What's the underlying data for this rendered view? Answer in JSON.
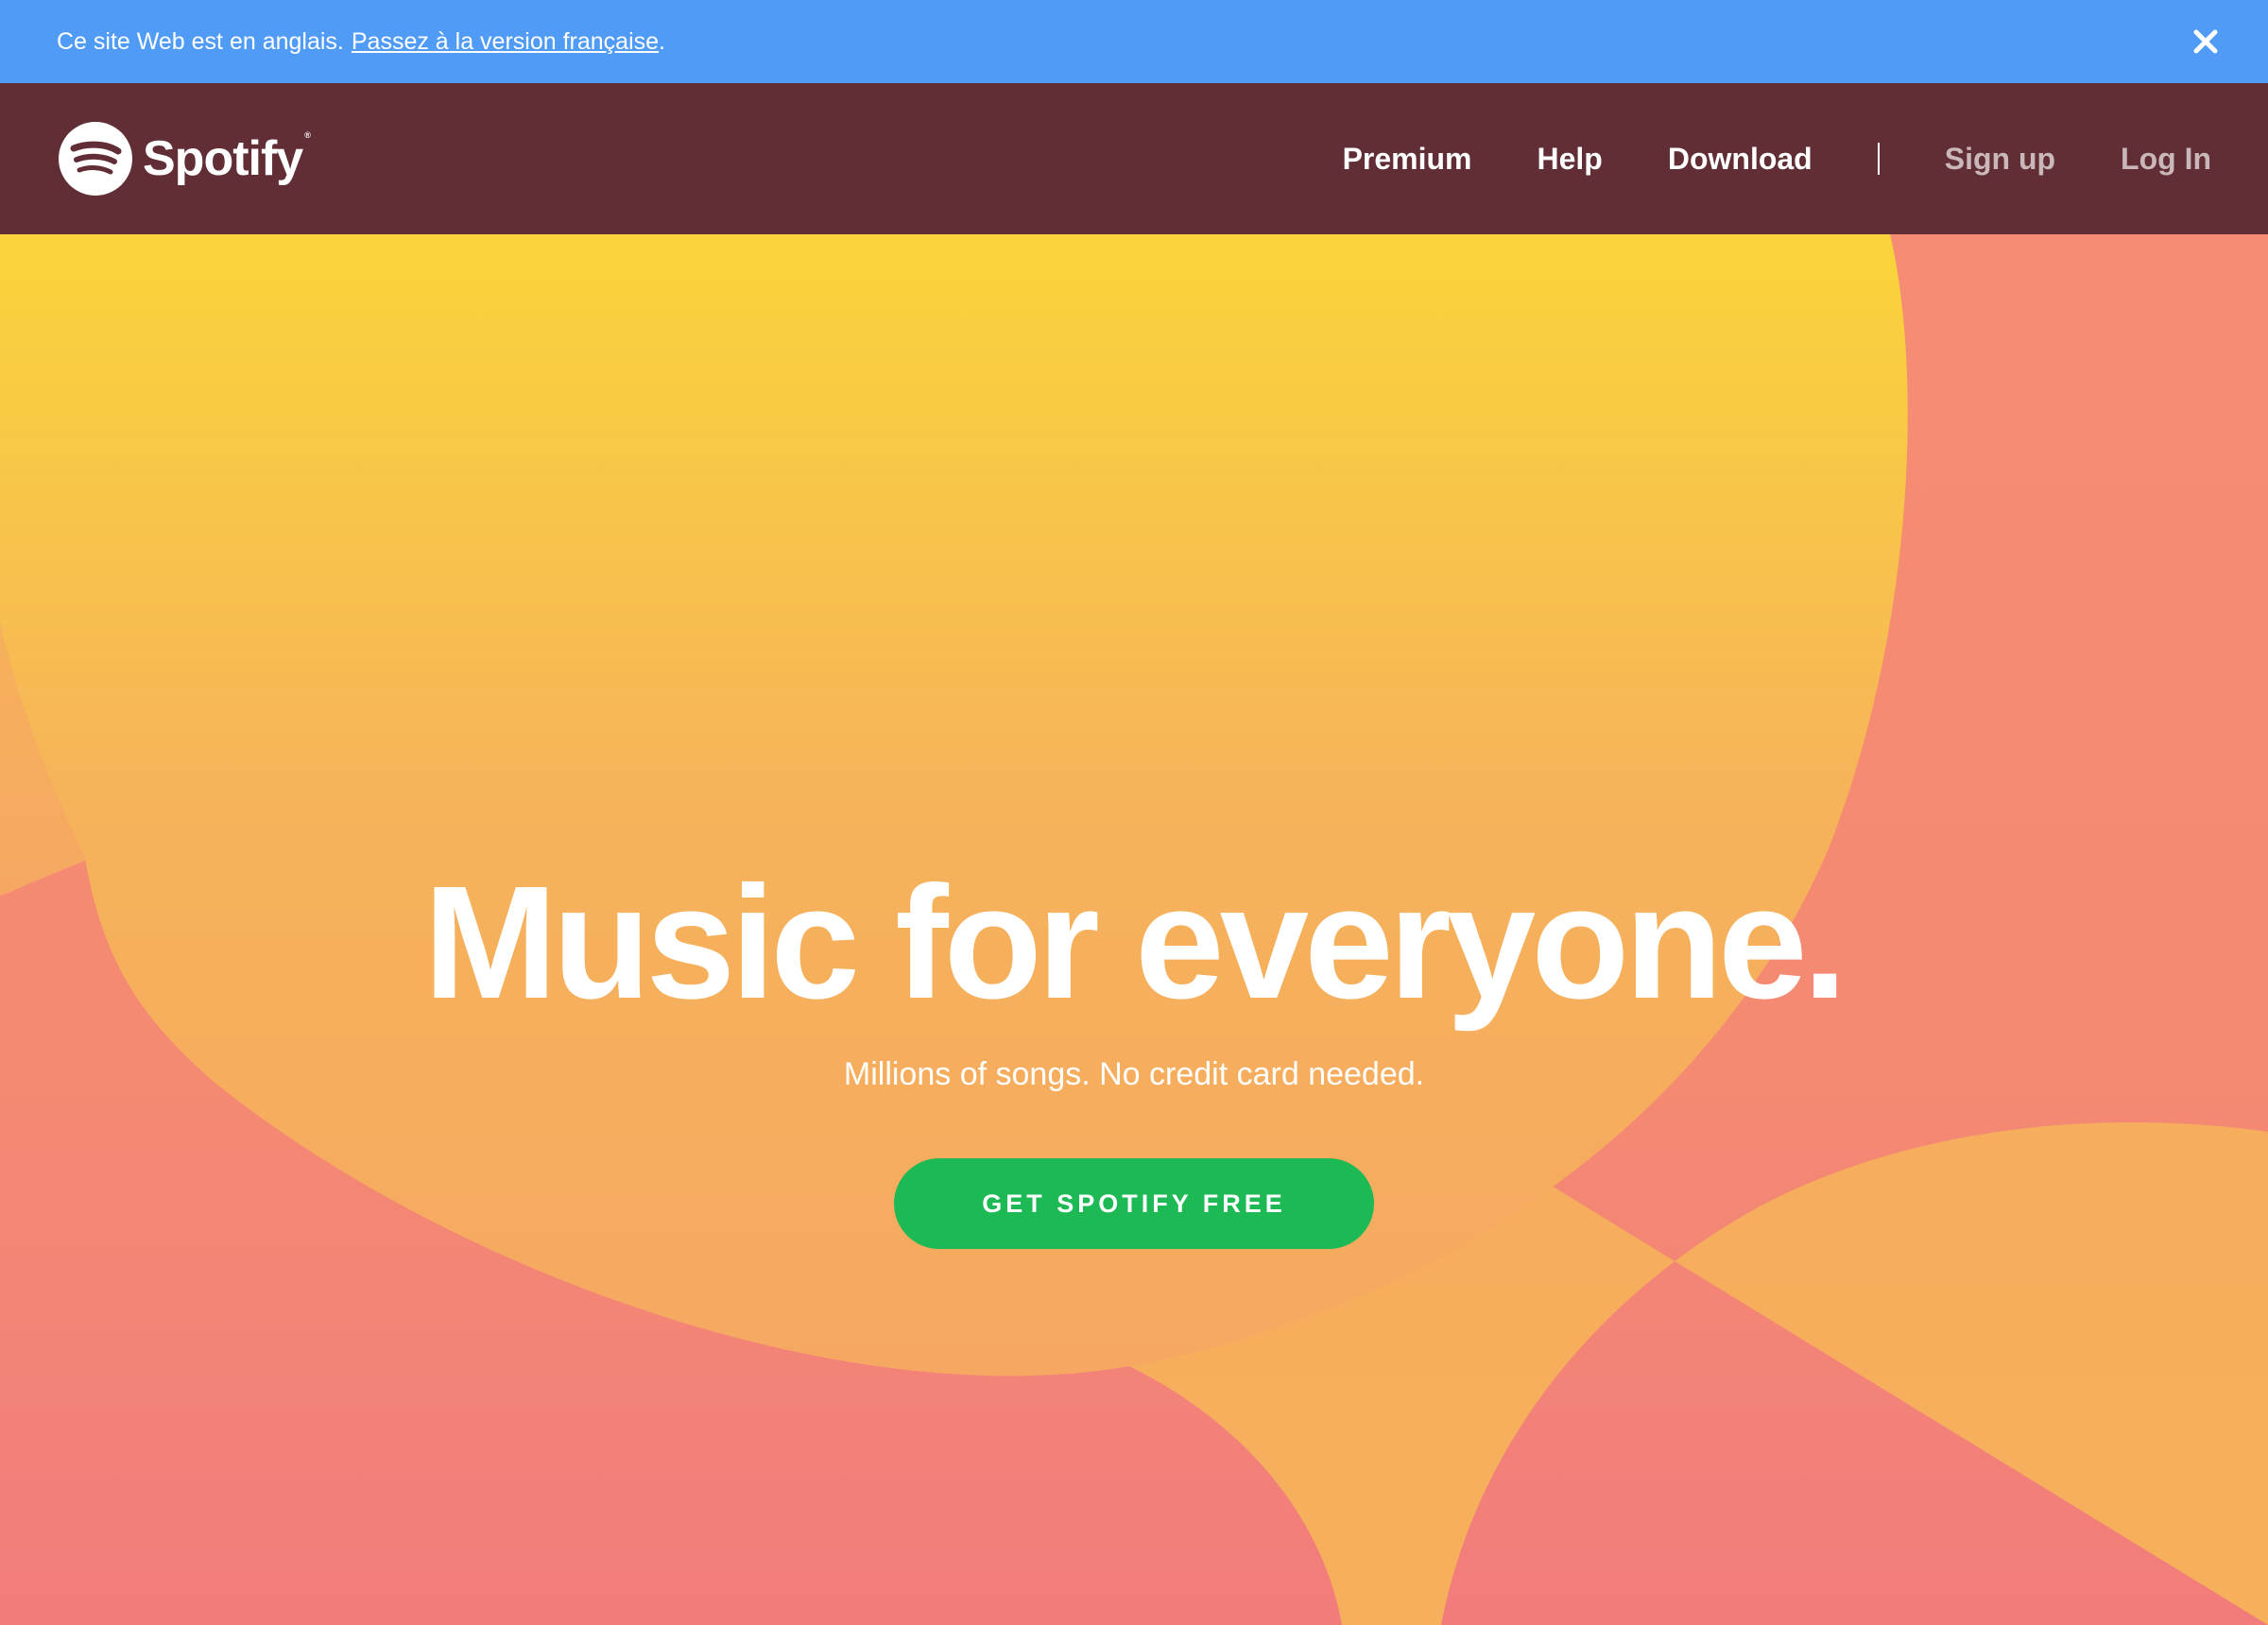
{
  "banner": {
    "message": "Ce site Web est en anglais.",
    "link_text": "Passez à la version française",
    "trailing": ".",
    "close_icon": "close-icon",
    "color": "#509bf5"
  },
  "nav": {
    "brand": "Spotify",
    "brand_mark": "®",
    "links": [
      {
        "label": "Premium"
      },
      {
        "label": "Help"
      },
      {
        "label": "Download"
      }
    ],
    "account": [
      {
        "label": "Sign up"
      },
      {
        "label": "Log In"
      }
    ],
    "color": "#612e35"
  },
  "hero": {
    "title": "Music for everyone.",
    "subtitle": "Millions of songs. No credit card needed.",
    "cta": "GET SPOTIFY FREE",
    "cta_color": "#1db954"
  }
}
